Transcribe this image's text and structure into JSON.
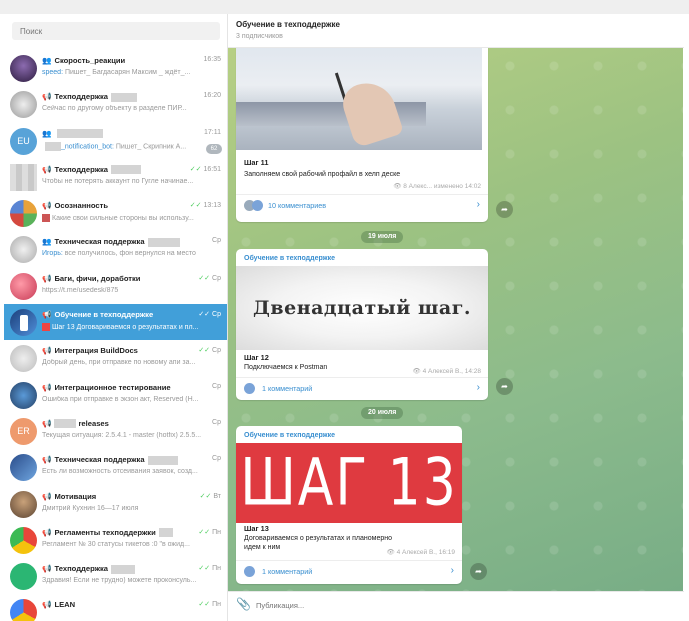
{
  "search": {
    "placeholder": "Поиск"
  },
  "chats": [
    {
      "kind": "group",
      "name": "Скорость_реакции",
      "time": "16:35",
      "sender": "speed:",
      "preview": "Пишет_ Багдасарян Максим _ ждёт_..."
    },
    {
      "kind": "channel",
      "name": "Техподдержка",
      "time": "16:20",
      "preview": "Сейчас по другому объекту в разделе ПИР..."
    },
    {
      "kind": "",
      "name": "",
      "time": "17:11",
      "avatar_text": "EU",
      "sender": "_notification_bot:",
      "preview": "Пишет_ Скрипник А...",
      "badge": "62"
    },
    {
      "kind": "channel",
      "name": "Техподдержка",
      "time": "16:51",
      "preview": "Чтобы не потерять аккаунт по Гугле начинае..."
    },
    {
      "kind": "channel",
      "name": "Осознанность",
      "time": "13:13",
      "preview": "Какие свои сильные стороны вы использу..."
    },
    {
      "kind": "group",
      "name": "Техническая поддержка",
      "time": "Ср",
      "sender": "Игорь:",
      "preview": "все получилось, фон вернулся на место"
    },
    {
      "kind": "channel",
      "name": "Баги, фичи, доработки",
      "time": "Ср",
      "preview": "https://t.me/usedesk/875"
    },
    {
      "kind": "channel",
      "name": "Обучение в техподдержке",
      "time": "Ср",
      "preview": "Шаг 13 Договариваемся о результатах и пл...",
      "active": true
    },
    {
      "kind": "channel",
      "name": "Интеграция BuildDocs",
      "time": "Ср",
      "preview": "Добрый день, при отправке по новому апи за..."
    },
    {
      "kind": "channel",
      "name": "Интеграционное тестирование",
      "time": "Ср",
      "preview": "Ошибка при отправке в экзон акт, Reserved (H..."
    },
    {
      "kind": "channel",
      "name": "releases",
      "time": "Ср",
      "avatar_text": "ER",
      "preview": "Текущая ситуация: 2.5.4.1 - master (hotfix) 2.5.5..."
    },
    {
      "kind": "channel",
      "name": "Техническая поддержка",
      "time": "Ср",
      "preview": "Есть ли возможность отсеивания заявок, созд..."
    },
    {
      "kind": "channel",
      "name": "Мотивация",
      "time": "Вт",
      "preview": "Дмитрий Кухнин 16—17 июля"
    },
    {
      "kind": "channel",
      "name": "Регламенты техподдержки",
      "time": "Пн",
      "preview": "Регламент № 30 статусы тикетов :0 \"в ожид..."
    },
    {
      "kind": "channel",
      "name": "Техподдержка",
      "time": "Пн",
      "preview": "Здравия! Если не трудно) можете проконсуль..."
    },
    {
      "kind": "channel",
      "name": "LEAN",
      "time": "Пн",
      "preview": ""
    }
  ],
  "channel": {
    "title": "Обучение в техподдержке",
    "subscribers": "3 подписчиков"
  },
  "posts": [
    {
      "step": "Шаг 11",
      "text": "Заполняем свой рабочий профайл в хелп деске",
      "meta": "8  Алекс... изменено 14:02",
      "comments": "10 комментариев"
    },
    {
      "date": "19 июля",
      "author": "Обучение в техподдержке",
      "image_text": "Двенадцатый шаг.",
      "step": "Шаг 12",
      "text": "Подключаемся к Postman",
      "meta": "4  Алексей В., 14:28",
      "comments": "1 комментарий"
    },
    {
      "date": "20 июля",
      "author": "Обучение в техподдержке",
      "image_text": "ШАГ 13",
      "step": "Шаг 13",
      "text": "Договариваемся о результатах и планомерно идем к ним",
      "meta": "4  Алексей В., 16:19",
      "comments": "1 комментарий"
    }
  ],
  "compose": {
    "placeholder": "Публикация..."
  }
}
